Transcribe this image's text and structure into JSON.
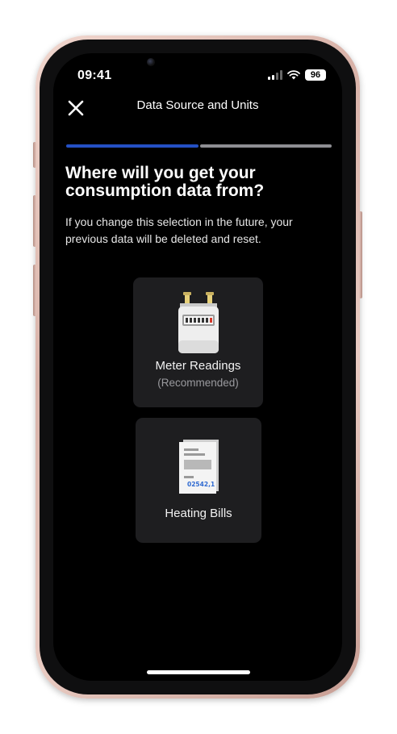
{
  "status_bar": {
    "time": "09:41",
    "battery": "96"
  },
  "header": {
    "close_icon": "close-icon",
    "title": "Data Source and Units"
  },
  "progress": {
    "completed_fraction": 0.5,
    "done_color": "#2450c4",
    "todo_color": "#8e8e93"
  },
  "content": {
    "question": "Where will you get your consumption data from?",
    "note": "If you change this selection in the future, your previous data will be deleted and reset."
  },
  "options": [
    {
      "icon": "gas-meter-icon",
      "label": "Meter Readings",
      "sublabel": "(Recommended)"
    },
    {
      "icon": "bill-document-icon",
      "label": "Heating Bills",
      "bill_number": "02542,1"
    }
  ],
  "colors": {
    "screen_bg": "#000000",
    "card_bg": "#1e1e20",
    "accent": "#2450c4"
  }
}
